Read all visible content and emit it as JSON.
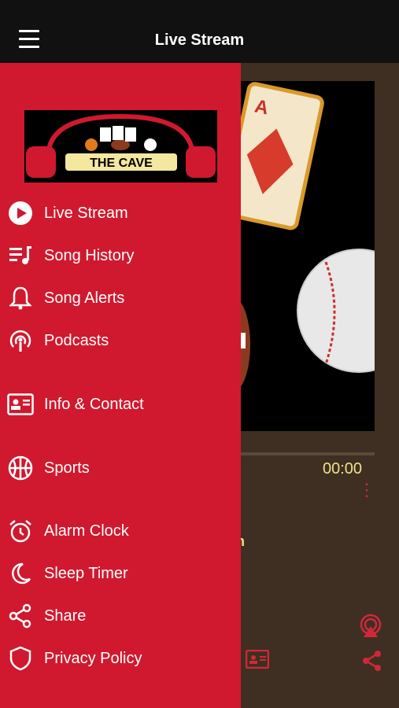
{
  "header": {
    "title": "Live Stream"
  },
  "logo": {
    "text": "THE CAVE"
  },
  "menu": [
    {
      "label": "Live Stream",
      "icon": "play-circle-icon"
    },
    {
      "label": "Song History",
      "icon": "playlist-icon"
    },
    {
      "label": "Song Alerts",
      "icon": "bell-icon"
    },
    {
      "label": "Podcasts",
      "icon": "podcast-icon"
    },
    {
      "label": "Info & Contact",
      "icon": "contact-card-icon"
    },
    {
      "label": "Sports",
      "icon": "basketball-icon"
    },
    {
      "label": "Alarm Clock",
      "icon": "alarm-clock-icon"
    },
    {
      "label": "Sleep Timer",
      "icon": "moon-icon"
    },
    {
      "label": "Share",
      "icon": "share-icon"
    },
    {
      "label": "Privacy Policy",
      "icon": "shield-icon"
    }
  ],
  "player": {
    "time": "00:00",
    "partial_text": "n"
  },
  "colors": {
    "drawer": "#d0192e",
    "topbar": "#111111",
    "background": "#3e2f22",
    "accent_text": "#f0e08a"
  }
}
